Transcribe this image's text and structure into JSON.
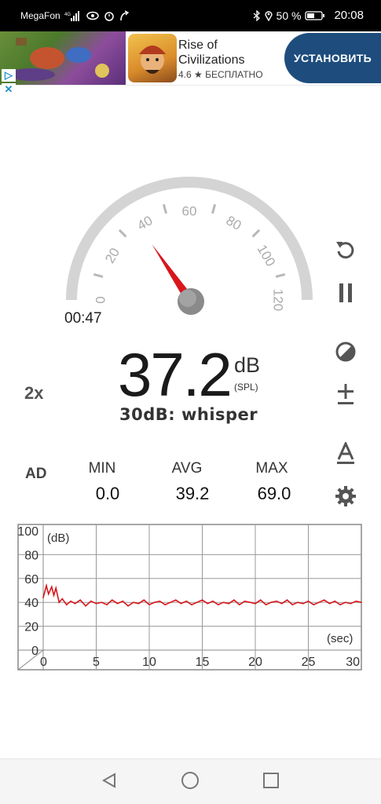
{
  "status_bar": {
    "carrier": "MegaFon",
    "battery": "50 %",
    "time": "20:08"
  },
  "ad": {
    "title": "Rise of Civilizations",
    "rating": "4.6 ★ БЕСПЛАТНО",
    "install_label": "УСТАНОВИТЬ",
    "info_badge": "▷",
    "close_badge": "✕"
  },
  "gauge": {
    "ticks": [
      "0",
      "20",
      "40",
      "60",
      "80",
      "100",
      "120"
    ],
    "needle_value": 37.2,
    "max": 120
  },
  "timer": "00:47",
  "reading": {
    "value": "37.2",
    "unit": "dB",
    "unit_sub": "(SPL)",
    "description": "30dB: whisper"
  },
  "speed_label": "2x",
  "ad_label": "AD",
  "stats": {
    "min_label": "MIN",
    "min_value": "0.0",
    "avg_label": "AVG",
    "avg_value": "39.2",
    "max_label": "MAX",
    "max_value": "69.0"
  },
  "graph": {
    "y_ticks": [
      "0",
      "20",
      "40",
      "60",
      "80",
      "100"
    ],
    "x_ticks": [
      "0",
      "5",
      "10",
      "15",
      "20",
      "25",
      "30"
    ],
    "y_unit": "(dB)",
    "x_unit": "(sec)"
  },
  "chart_data": {
    "type": "line",
    "xlabel": "(sec)",
    "ylabel": "(dB)",
    "xlim": [
      0,
      30
    ],
    "ylim": [
      0,
      100
    ],
    "series": [
      {
        "color": "#d9161b",
        "x": [
          0,
          0.3,
          0.5,
          0.8,
          1.0,
          1.2,
          1.5,
          1.8,
          2.2,
          2.6,
          3,
          3.5,
          4,
          4.5,
          5,
          5.5,
          6,
          6.5,
          7,
          7.5,
          8,
          8.5,
          9,
          9.5,
          10,
          10.5,
          11,
          11.5,
          12,
          12.5,
          13,
          13.5,
          14,
          14.5,
          15,
          15.5,
          16,
          16.5,
          17,
          17.5,
          18,
          18.5,
          19,
          19.5,
          20,
          20.5,
          21,
          21.5,
          22,
          22.5,
          23,
          23.5,
          24,
          24.5,
          25,
          25.5,
          26,
          26.5,
          27,
          27.5,
          28,
          28.5,
          29,
          29.5,
          30
        ],
        "y": [
          44,
          54,
          47,
          53,
          46,
          52,
          40,
          43,
          38,
          41,
          39,
          42,
          37,
          41,
          39,
          40,
          38,
          42,
          39,
          41,
          37,
          40,
          39,
          42,
          38,
          40,
          41,
          38,
          40,
          42,
          39,
          41,
          38,
          40,
          42,
          39,
          41,
          38,
          40,
          39,
          42,
          38,
          41,
          40,
          39,
          42,
          38,
          40,
          41,
          39,
          42,
          38,
          40,
          39,
          41,
          38,
          40,
          42,
          39,
          41,
          38,
          40,
          39,
          41,
          40
        ]
      }
    ]
  }
}
